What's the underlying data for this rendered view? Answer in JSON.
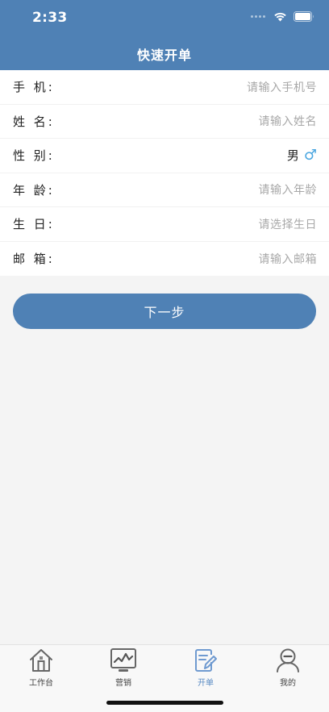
{
  "status_bar": {
    "time": "2:33"
  },
  "nav": {
    "title": "快速开单"
  },
  "form": {
    "rows": [
      {
        "label": "手 机:",
        "placeholder": "请输入手机号"
      },
      {
        "label": "姓 名:",
        "placeholder": "请输入姓名"
      },
      {
        "label": "性 别:",
        "value": "男",
        "icon": "male-symbol"
      },
      {
        "label": "年 龄:",
        "placeholder": "请输入年龄"
      },
      {
        "label": "生 日:",
        "placeholder": "请选择生日"
      },
      {
        "label": "邮 箱:",
        "placeholder": "请输入邮箱"
      }
    ]
  },
  "next_button": {
    "label": "下一步"
  },
  "tabbar": {
    "items": [
      {
        "label": "工作台",
        "icon": "home-icon"
      },
      {
        "label": "营销",
        "icon": "marketing-chart-icon"
      },
      {
        "label": "开单",
        "icon": "order-edit-icon",
        "active": true
      },
      {
        "label": "我的",
        "icon": "profile-icon"
      }
    ]
  },
  "colors": {
    "primary": "#4f81b5",
    "active_tab": "#5a8bc4",
    "placeholder": "#a8a8a8",
    "male_icon": "#4aa6e0"
  }
}
